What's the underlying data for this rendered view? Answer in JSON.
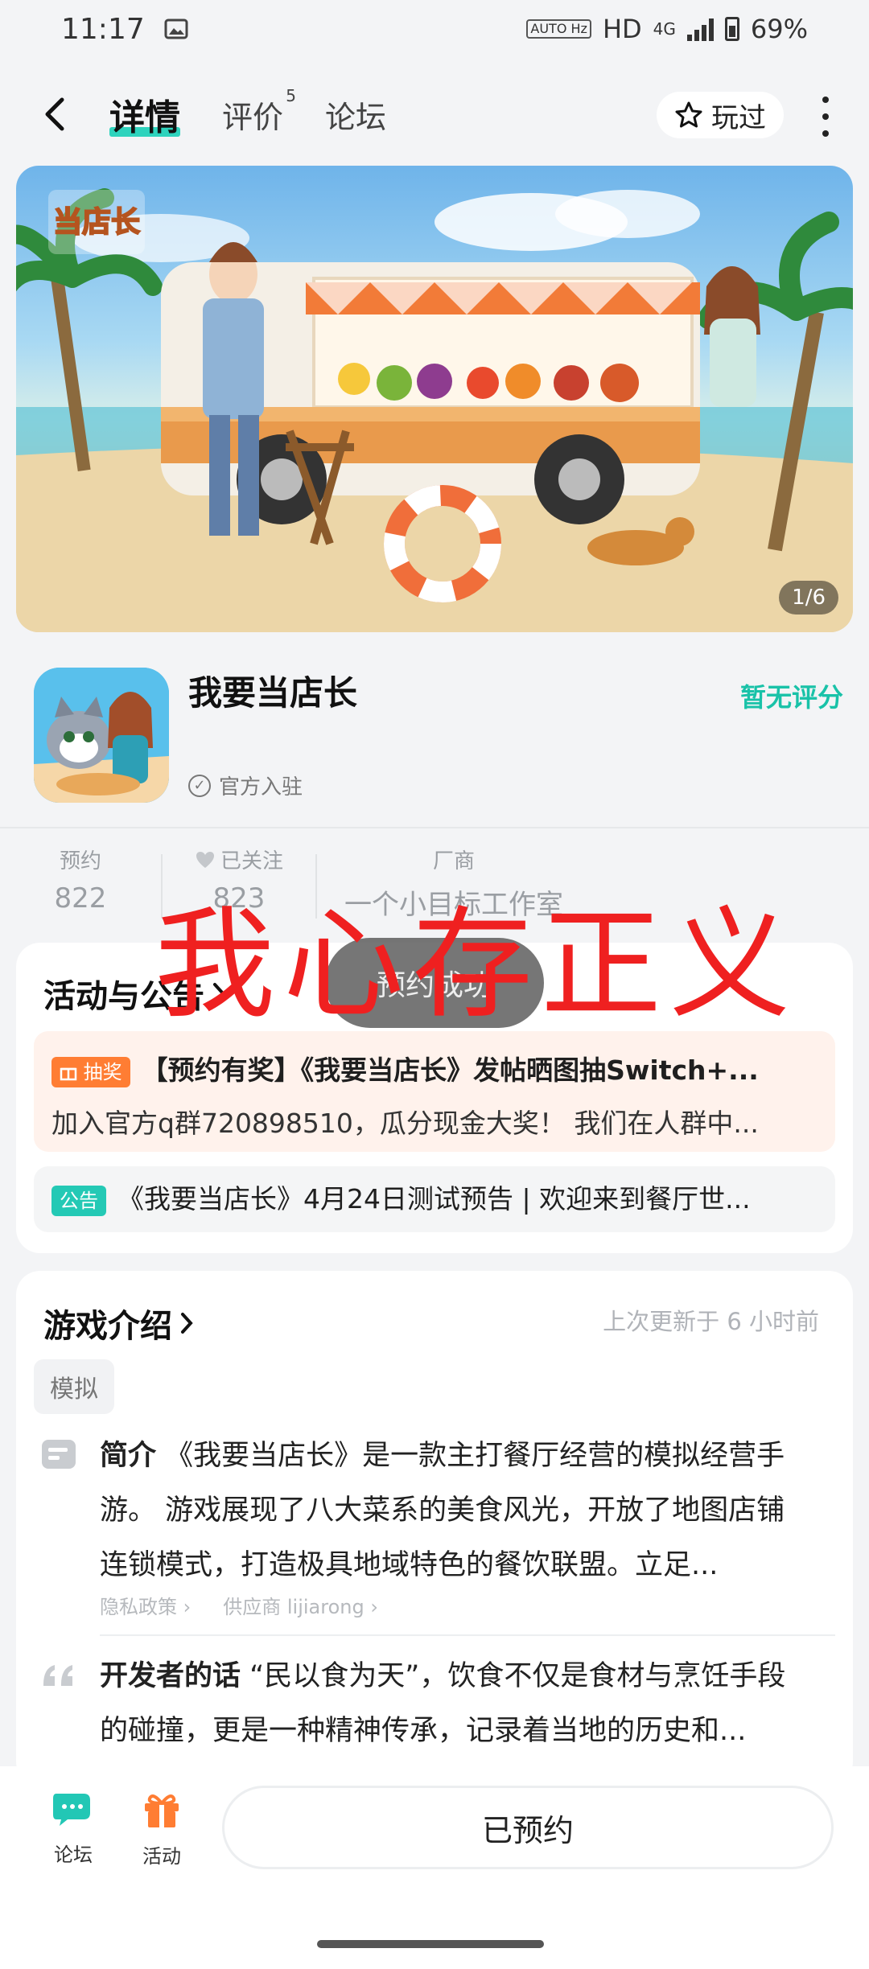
{
  "status_bar": {
    "time": "11:17",
    "network": "HD",
    "network_gen": "4G",
    "battery": "69%",
    "hz_badge": "AUTO Hz"
  },
  "nav": {
    "tabs": [
      {
        "label": "详情",
        "active": true
      },
      {
        "label": "评价",
        "badge": "5"
      },
      {
        "label": "论坛"
      }
    ],
    "played_label": "玩过"
  },
  "banner": {
    "logo_text": "我要当店长",
    "counter": "1/6"
  },
  "app": {
    "name": "我要当店长",
    "rating": "暂无评分",
    "official": "官方入驻"
  },
  "stats": [
    {
      "label": "预约",
      "value": "822"
    },
    {
      "label": "已关注",
      "value": "823"
    },
    {
      "label": "厂商",
      "value": "一个小目标工作室"
    }
  ],
  "activities": {
    "title": "活动与公告",
    "prize_tag": "抽奖",
    "prize_title": "【预约有奖】《我要当店长》发帖晒图抽Switch+...",
    "prize_desc": "加入官方q群720898510，瓜分现金大奖！ 我们在人群中...",
    "notice_tag": "公告",
    "notice_text": "《我要当店长》4月24日测试预告 | 欢迎来到餐厅世..."
  },
  "intro": {
    "title": "游戏介绍",
    "updated": "上次更新于 6 小时前",
    "tag": "模拟",
    "summary_label": "简介",
    "summary_text": "《我要当店长》是一款主打餐厅经营的模拟经营手游。 游戏展现了八大菜系的美食风光，开放了地图店铺连锁模式，打造极具地域特色的餐饮联盟。立足...",
    "privacy": "隐私政策",
    "provider": "供应商 lijiarong",
    "dev_label": "开发者的话",
    "dev_text": "“民以食为天”，饮食不仅是食材与烹饪手段的碰撞，更是一种精神传承，记录着当地的历史和..."
  },
  "bottom": {
    "forum_label": "论坛",
    "activity_label": "活动",
    "reserve_label": "已预约"
  },
  "toast": "预约成功",
  "overlay_text": "我心存正义",
  "colors": {
    "accent": "#2ed3bd",
    "teal_text": "#19c2a8",
    "prize": "#ff7d33",
    "overlay": "#ef2020"
  }
}
